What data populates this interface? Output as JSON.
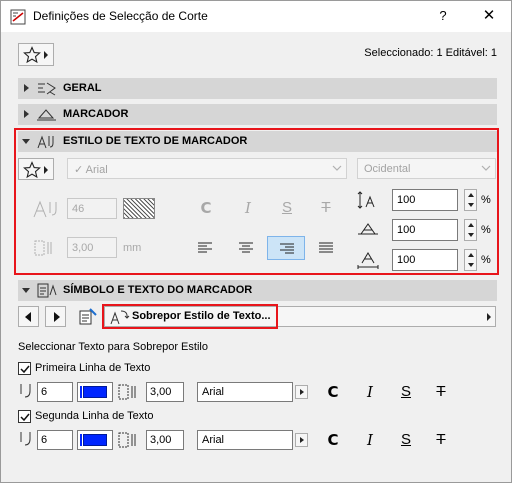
{
  "window": {
    "title": "Definições de Selecção de Corte",
    "help_label": "?",
    "close_label": "✕"
  },
  "header": {
    "selected_info": "Seleccionado: 1 Editável: 1"
  },
  "sections": {
    "geral": "GERAL",
    "marcador": "MARCADOR",
    "estilo": "ESTILO DE TEXTO DE MARCADOR",
    "simbolo": "SÍMBOLO E TEXTO DO MARCADOR"
  },
  "text_style": {
    "font_value": "✓ Arial",
    "script_value": "Ocidental",
    "height_value": "46",
    "spacing_value": "3,00",
    "spacing_unit": "mm",
    "bold_label": "C",
    "italic_label": "I",
    "underline_label": "S",
    "strike_label": "T",
    "width_factor": "100",
    "slant_value": "100",
    "char_spacing": "100",
    "percent": "%",
    "selected_alignment": "right"
  },
  "symbol": {
    "override_label": "Sobrepor Estilo de Texto...",
    "select_label": "Seleccionar Texto para Sobrepor Estilo",
    "line1": {
      "checked": true,
      "label": "Primeira Linha de Texto",
      "pen": "6",
      "spacing": "3,00",
      "font": "Arial"
    },
    "line2": {
      "checked": true,
      "label": "Segunda Linha de Texto",
      "pen": "6",
      "spacing": "3,00",
      "font": "Arial"
    },
    "bold_label": "C",
    "italic_label": "I",
    "underline_label": "S",
    "strike_label": "T"
  },
  "colors": {
    "highlight_border": "#e8151b",
    "pen_color": "#0026ff",
    "section_bg": "#d6d6d6",
    "selected_align_bg": "#cce4f7"
  }
}
